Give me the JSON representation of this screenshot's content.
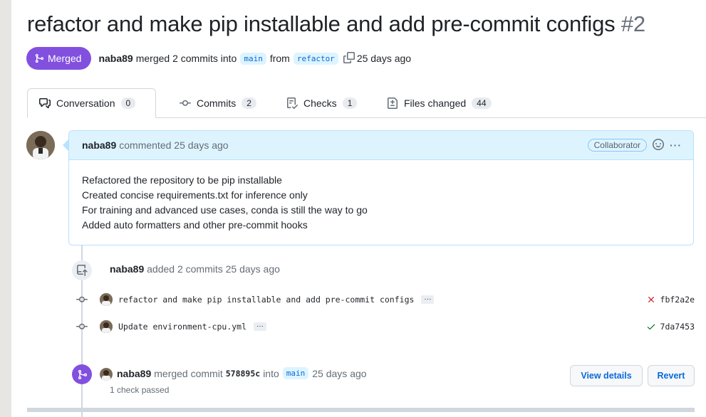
{
  "pr": {
    "title": "refactor and make pip installable and add pre-commit configs",
    "number": "#2",
    "state_label": "Merged",
    "author": "naba89",
    "summary_text": "merged 2 commits into",
    "base_branch": "main",
    "from_text": "from",
    "head_branch": "refactor",
    "time_text": "25 days ago"
  },
  "tabs": [
    {
      "label": "Conversation",
      "count": "0",
      "icon": "comment-icon"
    },
    {
      "label": "Commits",
      "count": "2",
      "icon": "commit-icon"
    },
    {
      "label": "Checks",
      "count": "1",
      "icon": "checklist-icon"
    },
    {
      "label": "Files changed",
      "count": "44",
      "icon": "file-diff-icon"
    }
  ],
  "comment": {
    "author": "naba89",
    "when": "commented 25 days ago",
    "badge": "Collaborator",
    "more": "···",
    "lines": [
      "Refactored the repository to be pip installable",
      "Created concise requirements.txt for inference only",
      "For training and advanced use cases, conda is still the way to go",
      "Added auto formatters and other pre-commit hooks"
    ]
  },
  "commits_event": {
    "author": "naba89",
    "text": "added 2 commits 25 days ago"
  },
  "commits": [
    {
      "message": "refactor and make pip installable and add pre-commit configs",
      "ellipsis": "···",
      "status_icon": "x-icon",
      "status_color": "#cf222e",
      "sha": "fbf2a2e"
    },
    {
      "message": "Update environment-cpu.yml",
      "ellipsis": "···",
      "status_icon": "check-icon",
      "status_color": "#1a7f37",
      "sha": "7da7453"
    }
  ],
  "merge_event": {
    "author": "naba89",
    "text1": "merged commit",
    "sha": "578895c",
    "text2": "into",
    "branch": "main",
    "time": "25 days ago",
    "sub": "1 check passed",
    "view_details": "View details",
    "revert": "Revert"
  },
  "colors": {
    "merged": "#8250df",
    "link": "#0969da"
  }
}
